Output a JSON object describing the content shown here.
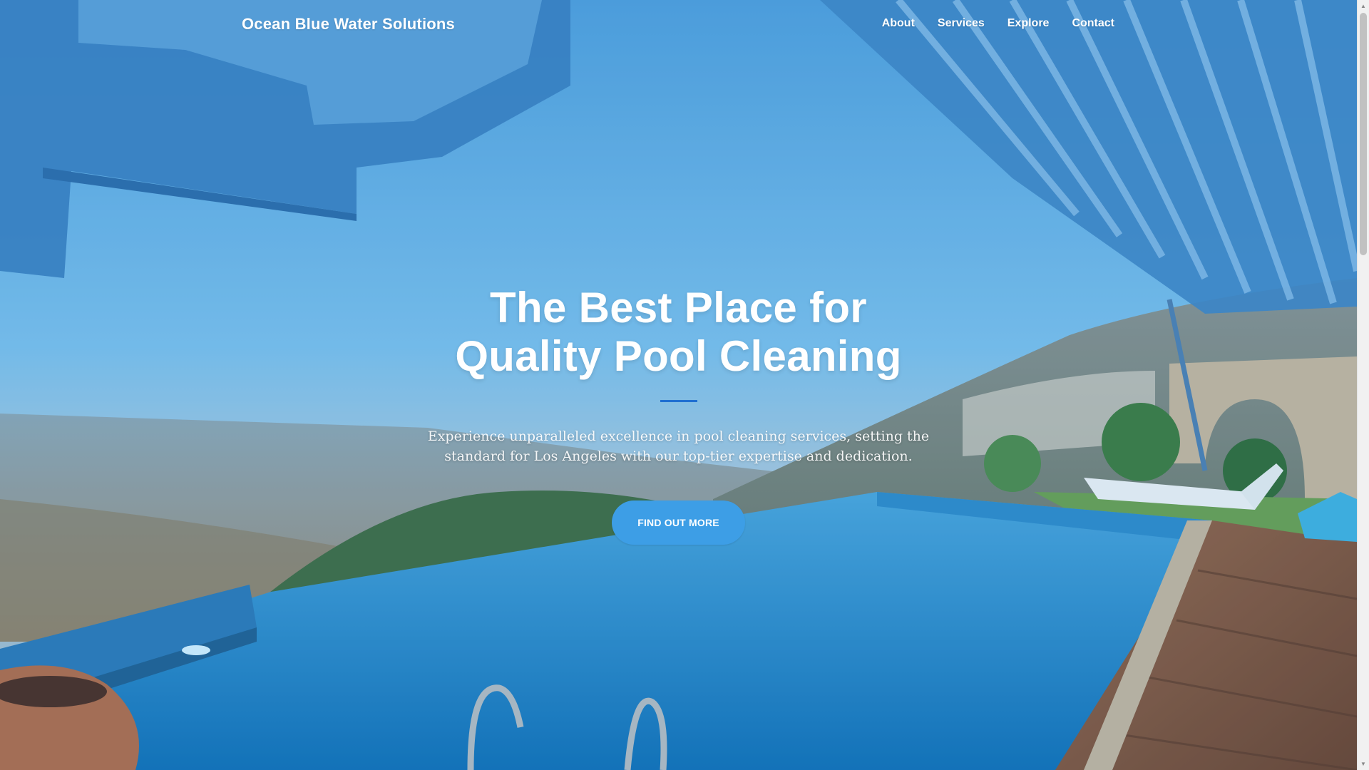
{
  "nav": {
    "brand": "Ocean Blue Water Solutions",
    "links": [
      "About",
      "Services",
      "Explore",
      "Contact"
    ]
  },
  "masthead": {
    "headline_line1": "The Best Place for",
    "headline_line2": "Quality Pool Cleaning",
    "lead": "Experience unparalleled excellence in pool cleaning services, setting the standard for Los Angeles with our top-tier expertise and dedication.",
    "cta_label": "FIND OUT MORE"
  },
  "colors": {
    "sky": "#5aa6dc",
    "accent_divider": "#1f6fd1",
    "cta": "#3d9ee6",
    "pool": "#1e88c9",
    "deck": "#8a5a3c"
  },
  "icons": {
    "scroll_up": "chevron-up-icon",
    "scroll_down": "chevron-down-icon"
  }
}
